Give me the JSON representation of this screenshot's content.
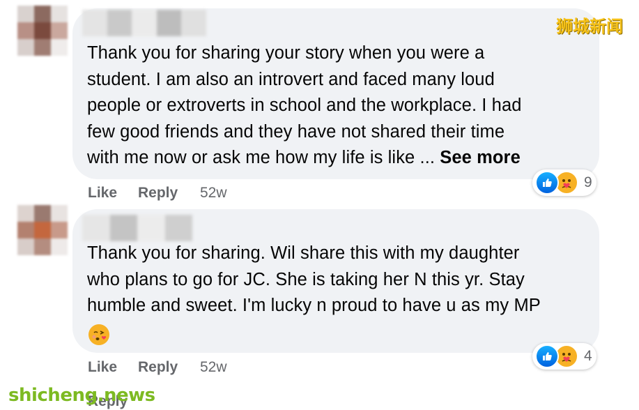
{
  "watermark": {
    "top": "狮城新闻",
    "bottom": "shicheng.news"
  },
  "comments": [
    {
      "text_lines": [
        "Thank you for sharing your story when you were a",
        "student. I am also an introvert and faced many loud",
        "people or extroverts in school and the workplace. I had",
        "few good friends and they have not shared their time",
        "with me now or ask me how my life is like ..."
      ],
      "see_more": "See more",
      "like_label": "Like",
      "reply_label": "Reply",
      "timestamp": "52w",
      "reaction_count": "9",
      "reaction_icons": [
        "like-icon",
        "care-icon"
      ]
    },
    {
      "text_lines": [
        "Thank you for sharing. Wil share this with my daughter",
        "who plans to go for JC. She is taking her N this yr. Stay",
        "humble and sweet. I'm lucky n proud to have u as my MP"
      ],
      "emoji": "face-blowing-kiss",
      "like_label": "Like",
      "reply_label": "Reply",
      "timestamp": "52w",
      "reaction_count": "4",
      "reaction_icons": [
        "like-icon",
        "care-icon"
      ]
    }
  ],
  "partial_reply_label": "Reply",
  "colors": {
    "bubble": "#f0f2f5",
    "meta": "#65676b",
    "like": "#1877f2",
    "care": "#f7b125"
  }
}
